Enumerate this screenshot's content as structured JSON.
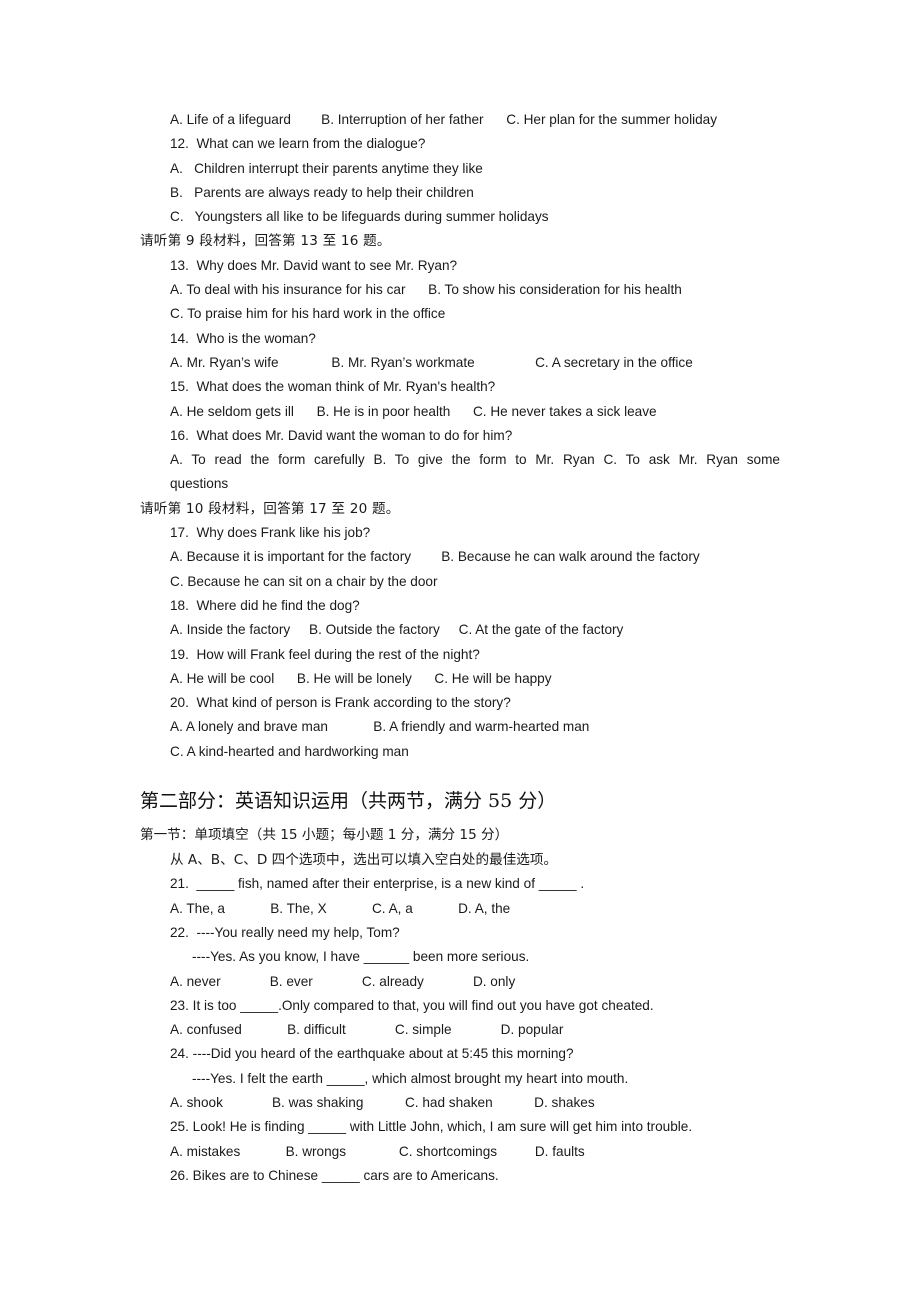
{
  "document": {
    "type": "exam-paper",
    "language": "zh-CN/en",
    "page_background": "#ffffff",
    "text_color": "#1a1a1a"
  },
  "listening_section": {
    "q11_options": "A. Life of a lifeguard        B. Interruption of her father      C. Her plan for the summer holiday",
    "q12_stem": "12.  What can we learn from the dialogue?",
    "q12_a": "A.   Children interrupt their parents anytime they like",
    "q12_b": "B.   Parents are always ready to help their children",
    "q12_c": "C.   Youngsters all like to be lifeguards during summer holidays",
    "material9_directive": "请听第 9 段材料，回答第 13 至 16 题。",
    "q13_stem": "13.  Why does Mr. David want to see Mr. Ryan?",
    "q13_ab": "A. To deal with his insurance for his car      B. To show his consideration for his health",
    "q13_c": "C. To praise him for his hard work in the office",
    "q14_stem": "14.  Who is the woman?",
    "q14_options": "A. Mr. Ryan’s wife              B. Mr. Ryan’s workmate                C. A secretary in the office",
    "q15_stem": "15.  What does the woman think of Mr. Ryan's health?",
    "q15_options": "A. He seldom gets ill      B. He is in poor health      C. He never takes a sick leave",
    "q16_stem": "16.  What does Mr. David want the woman to do for him?",
    "q16_options_line1": "A. To read the form carefully B. To give the form to Mr. Ryan C. To ask Mr. Ryan some",
    "q16_options_line2": "questions",
    "material10_directive": "请听第 10 段材料，回答第 17 至 20 题。",
    "q17_stem": "17.  Why does Frank like his job?",
    "q17_ab": "A. Because it is important for the factory        B. Because he can walk around the factory",
    "q17_c": "C. Because he can sit on a chair by the door",
    "q18_stem": "18.  Where did he find the dog?",
    "q18_options": "A. Inside the factory     B. Outside the factory     C. At the gate of the factory",
    "q19_stem": "19.  How will Frank feel during the rest of the night?",
    "q19_options": "A. He will be cool      B. He will be lonely      C. He will be happy",
    "q20_stem": "20.  What kind of person is Frank according to the story?",
    "q20_ab": "A. A lonely and brave man            B. A friendly and warm-hearted man",
    "q20_c": "C. A kind-hearted and hardworking man"
  },
  "part_two": {
    "heading": "第二部分：英语知识运用（共两节，满分 55 分）",
    "section_one_heading": "第一节：单项填空（共 15 小题；每小题 1 分，满分 15 分）",
    "instruction": "从 A、B、C、D 四个选项中，选出可以填入空白处的最佳选项。",
    "questions": [
      {
        "stem": "21.  _____ fish, named after their enterprise, is a new kind of _____ .",
        "options": "A. The, a            B. The, X            C. A, a            D. A, the"
      },
      {
        "stem": "22.  ----You really need my help, Tom?",
        "stem2": "----Yes. As you know, I have ______ been more serious.",
        "options": "A. never             B. ever             C. already             D. only"
      },
      {
        "stem": "23. It is too _____.Only compared to that, you will find out you have got cheated.",
        "options": "A. confused            B. difficult             C. simple             D. popular"
      },
      {
        "stem": "24. ----Did you heard of the earthquake about at 5:45 this morning?",
        "stem2": "----Yes. I felt the earth _____, which almost brought my heart into mouth.",
        "options": "A. shook             B. was shaking           C. had shaken           D. shakes"
      },
      {
        "stem": "25. Look! He is finding _____ with Little John, which, I am sure will get him into trouble.",
        "options": "A. mistakes            B. wrongs              C. shortcomings          D. faults"
      },
      {
        "stem": "26. Bikes are to Chinese _____ cars are to Americans.",
        "options": ""
      }
    ]
  }
}
